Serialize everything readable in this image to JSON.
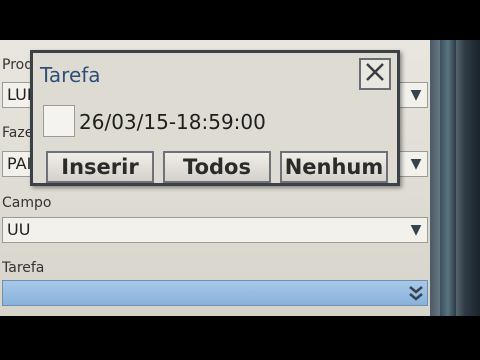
{
  "background_form": {
    "label_1": "Prod",
    "field_1": "LUI",
    "label_2": "Faze",
    "field_2": "PAI",
    "label_campo": "Campo",
    "field_campo": "UU",
    "label_tarefa": "Tarefa",
    "field_tarefa": ""
  },
  "dialog": {
    "title": "Tarefa",
    "close_icon": "close-icon",
    "item_label": "26/03/15-18:59:00",
    "item_checked": false,
    "buttons": {
      "insert": "Inserir",
      "all": "Todos",
      "none": "Nenhum"
    }
  },
  "colors": {
    "dialog_title": "#2f4f78",
    "selected_field": "#88b2dc"
  }
}
